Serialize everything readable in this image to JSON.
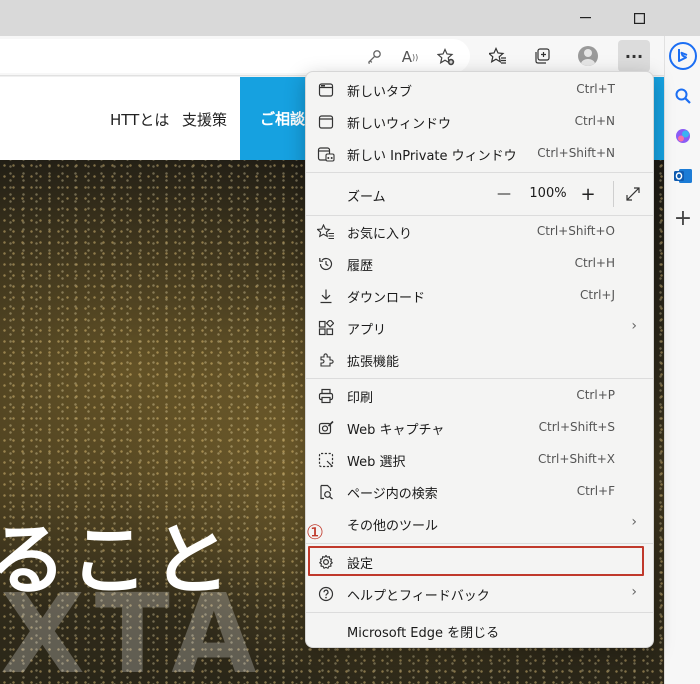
{
  "window": {
    "minimize_icon": "minimize-icon",
    "maximize_icon": "maximize-icon"
  },
  "toolbar": {
    "icons": [
      "key-icon",
      "read-aloud-icon",
      "add-favorite-icon",
      "favorites-icon",
      "collections-icon",
      "profile-icon",
      "more-icon"
    ],
    "read_aloud_label": "A",
    "more_label": "···"
  },
  "sidebar": {
    "icons": [
      "bing-icon",
      "search-icon",
      "copilot-icon",
      "outlook-icon",
      "add-icon"
    ],
    "add_label": "+"
  },
  "site": {
    "nav": [
      "HTTとは",
      "支援策"
    ],
    "cta_label": "ご相談",
    "hero_text": "ること",
    "hero_ghost": "XTA"
  },
  "menu": {
    "items": [
      {
        "label": "新しいタブ",
        "shortcut": "Ctrl+T",
        "icon": "new-tab-icon"
      },
      {
        "label": "新しいウィンドウ",
        "shortcut": "Ctrl+N",
        "icon": "new-window-icon"
      },
      {
        "label": "新しい InPrivate ウィンドウ",
        "shortcut": "Ctrl+Shift+N",
        "icon": "inprivate-icon"
      },
      {
        "label": "お気に入り",
        "shortcut": "Ctrl+Shift+O",
        "icon": "favorites-icon"
      },
      {
        "label": "履歴",
        "shortcut": "Ctrl+H",
        "icon": "history-icon"
      },
      {
        "label": "ダウンロード",
        "shortcut": "Ctrl+J",
        "icon": "download-icon"
      },
      {
        "label": "アプリ",
        "shortcut": "",
        "icon": "apps-icon",
        "submenu": true
      },
      {
        "label": "拡張機能",
        "shortcut": "",
        "icon": "extensions-icon"
      },
      {
        "label": "印刷",
        "shortcut": "Ctrl+P",
        "icon": "print-icon"
      },
      {
        "label": "Web キャプチャ",
        "shortcut": "Ctrl+Shift+S",
        "icon": "web-capture-icon"
      },
      {
        "label": "Web 選択",
        "shortcut": "Ctrl+Shift+X",
        "icon": "web-select-icon"
      },
      {
        "label": "ページ内の検索",
        "shortcut": "Ctrl+F",
        "icon": "find-icon"
      },
      {
        "label": "その他のツール",
        "shortcut": "",
        "icon": "more-tools-icon",
        "submenu": true
      },
      {
        "label": "設定",
        "shortcut": "",
        "icon": "settings-icon"
      },
      {
        "label": "ヘルプとフィードバック",
        "shortcut": "",
        "icon": "help-icon",
        "submenu": true
      },
      {
        "label": "Microsoft Edge を閉じる",
        "shortcut": "",
        "icon": ""
      }
    ],
    "zoom": {
      "label": "ズーム",
      "value": "100%",
      "minus": "—",
      "plus": "+",
      "expand_icon": "fullscreen-icon"
    },
    "arrow": "›"
  },
  "annotation": {
    "marker": "①",
    "highlight_color": "#c0392b"
  },
  "colors": {
    "accent": "#16a1e0",
    "bing_blue": "#1b6ef3"
  }
}
